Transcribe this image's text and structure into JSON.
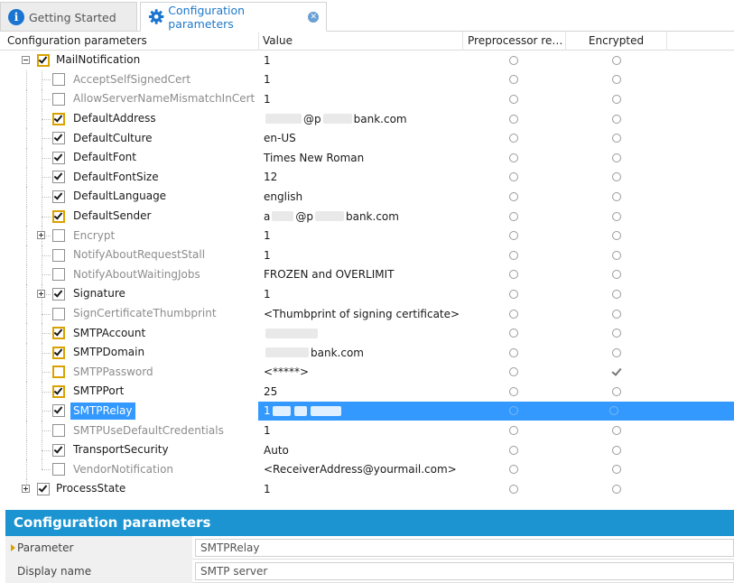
{
  "tabs": [
    {
      "label": "Getting Started",
      "icon": "info-icon",
      "active": false
    },
    {
      "label": "Configuration parameters",
      "icon": "gear-icon",
      "active": true
    }
  ],
  "columns": {
    "name": "Configuration parameters",
    "value": "Value",
    "preprocessor": "Preprocessor rel...",
    "encrypted": "Encrypted"
  },
  "rows": [
    {
      "name": "MailNotification",
      "value": "1",
      "level": 0,
      "expander": "minus",
      "checked": true,
      "highlight": true,
      "dim": false,
      "encrypted": false
    },
    {
      "name": "AcceptSelfSignedCert",
      "value": "1",
      "level": 1,
      "expander": null,
      "checked": false,
      "highlight": false,
      "dim": true,
      "encrypted": false
    },
    {
      "name": "AllowServerNameMismatchInCert",
      "value": "1",
      "level": 1,
      "expander": null,
      "checked": false,
      "highlight": false,
      "dim": true,
      "encrypted": false
    },
    {
      "name": "DefaultAddress",
      "value": "@p bank.com",
      "redact": [
        0,
        40
      ],
      "value_parts": [
        "",
        "@p",
        "bank.com"
      ],
      "level": 1,
      "expander": null,
      "checked": true,
      "highlight": true,
      "dim": false,
      "encrypted": false
    },
    {
      "name": "DefaultCulture",
      "value": "en-US",
      "level": 1,
      "expander": null,
      "checked": true,
      "highlight": false,
      "dim": false,
      "encrypted": false
    },
    {
      "name": "DefaultFont",
      "value": "Times New Roman",
      "level": 1,
      "expander": null,
      "checked": true,
      "highlight": false,
      "dim": false,
      "encrypted": false
    },
    {
      "name": "DefaultFontSize",
      "value": "12",
      "level": 1,
      "expander": null,
      "checked": true,
      "highlight": false,
      "dim": false,
      "encrypted": false
    },
    {
      "name": "DefaultLanguage",
      "value": "english",
      "level": 1,
      "expander": null,
      "checked": true,
      "highlight": false,
      "dim": false,
      "encrypted": false
    },
    {
      "name": "DefaultSender",
      "value": "a@p bank.com",
      "value_parts": [
        "a",
        "@p",
        "bank.com"
      ],
      "level": 1,
      "expander": null,
      "checked": true,
      "highlight": true,
      "dim": false,
      "encrypted": false
    },
    {
      "name": "Encrypt",
      "value": "1",
      "level": 1,
      "expander": "plus",
      "checked": false,
      "highlight": false,
      "dim": true,
      "encrypted": false
    },
    {
      "name": "NotifyAboutRequestStall",
      "value": "1",
      "level": 1,
      "expander": null,
      "checked": false,
      "highlight": false,
      "dim": true,
      "encrypted": false
    },
    {
      "name": "NotifyAboutWaitingJobs",
      "value": "FROZEN and OVERLIMIT",
      "level": 1,
      "expander": null,
      "checked": false,
      "highlight": false,
      "dim": true,
      "encrypted": false
    },
    {
      "name": "Signature",
      "value": "1",
      "level": 1,
      "expander": "plus",
      "checked": true,
      "highlight": false,
      "dim": false,
      "encrypted": false
    },
    {
      "name": "SignCertificateThumbprint",
      "value": "<Thumbprint of signing certificate>",
      "level": 1,
      "expander": null,
      "checked": false,
      "highlight": false,
      "dim": true,
      "encrypted": false
    },
    {
      "name": "SMTPAccount",
      "value": "",
      "value_parts": [
        "",
        "",
        ""
      ],
      "level": 1,
      "expander": null,
      "checked": true,
      "highlight": true,
      "dim": false,
      "encrypted": false
    },
    {
      "name": "SMTPDomain",
      "value": "bank.com",
      "value_parts": [
        "",
        "",
        "bank.com"
      ],
      "level": 1,
      "expander": null,
      "checked": true,
      "highlight": true,
      "dim": false,
      "encrypted": false
    },
    {
      "name": "SMTPPassword",
      "value": "<*****>",
      "level": 1,
      "expander": null,
      "checked": false,
      "highlight": true,
      "dim": true,
      "encrypted": true
    },
    {
      "name": "SMTPPort",
      "value": "25",
      "level": 1,
      "expander": null,
      "checked": true,
      "highlight": true,
      "dim": false,
      "encrypted": false
    },
    {
      "name": "SMTPRelay",
      "value": "1",
      "value_parts": [
        "1",
        "",
        ""
      ],
      "level": 1,
      "expander": null,
      "checked": true,
      "highlight": false,
      "dim": false,
      "encrypted": false,
      "selected": true
    },
    {
      "name": "SMTPUseDefaultCredentials",
      "value": "1",
      "level": 1,
      "expander": null,
      "checked": false,
      "highlight": false,
      "dim": true,
      "encrypted": false
    },
    {
      "name": "TransportSecurity",
      "value": "Auto",
      "level": 1,
      "expander": null,
      "checked": true,
      "highlight": false,
      "dim": false,
      "encrypted": false
    },
    {
      "name": "VendorNotification",
      "value": "<ReceiverAddress@yourmail.com>",
      "level": 1,
      "expander": null,
      "checked": false,
      "highlight": false,
      "dim": true,
      "encrypted": false
    },
    {
      "name": "ProcessState",
      "value": "1",
      "level": 0,
      "expander": "plus",
      "checked": true,
      "highlight": false,
      "dim": false,
      "encrypted": false
    }
  ],
  "properties": {
    "title": "Configuration parameters",
    "items": [
      {
        "label": "Parameter",
        "value": "SMTPRelay",
        "current": true
      },
      {
        "label": "Display name",
        "value": "SMTP server",
        "current": false
      }
    ]
  },
  "colors": {
    "accent": "#1b94d1",
    "selection": "#3399ff",
    "tab_active_text": "#1f78c8",
    "highlight_border": "#d9a100"
  }
}
